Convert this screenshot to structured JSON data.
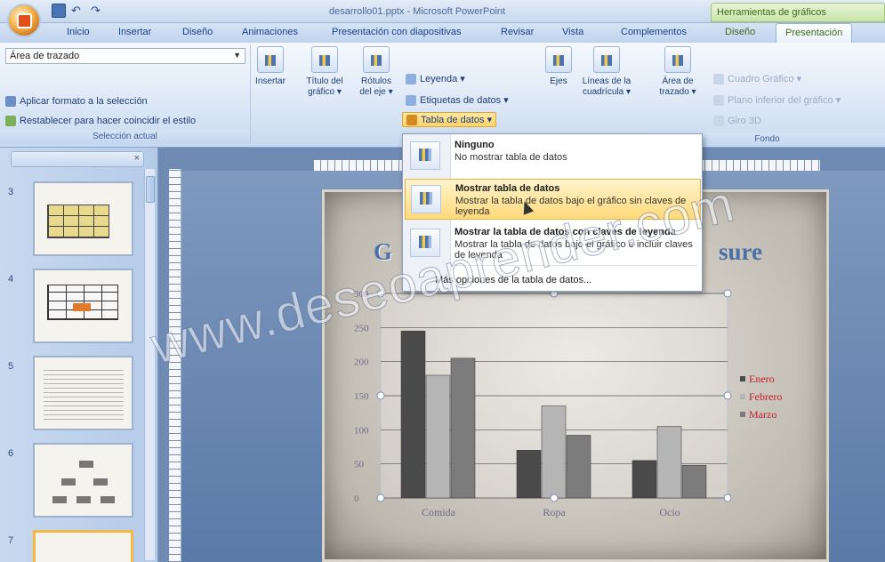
{
  "window": {
    "title": "desarrollo01.pptx - Microsoft PowerPoint",
    "contextual_title": "Herramientas de gráficos"
  },
  "tabs": [
    {
      "label": "Inicio"
    },
    {
      "label": "Insertar"
    },
    {
      "label": "Diseño"
    },
    {
      "label": "Animaciones"
    },
    {
      "label": "Presentación con diapositivas"
    },
    {
      "label": "Revisar"
    },
    {
      "label": "Vista"
    },
    {
      "label": "Complementos"
    },
    {
      "label": "Diseño"
    },
    {
      "label": "Presentación"
    }
  ],
  "ribbon": {
    "seleccion": {
      "combo_value": "Área de trazado",
      "format_btn": "Aplicar formato a la selección",
      "reset_btn": "Restablecer para hacer coincidir el estilo",
      "group_label": "Selección actual"
    },
    "insertar_btn": "Insertar",
    "titulo_btn": "Título del gráfico ▾",
    "rotulos_btn": "Rótulos del eje ▾",
    "leyenda_btn": "Leyenda ▾",
    "etiquetas_btn": "Etiquetas de datos ▾",
    "tabla_btn": "Tabla de datos ▾",
    "ejes_btn": "Ejes",
    "lineas_btn": "Líneas de la cuadrícula ▾",
    "area_btn": "Área de trazado ▾",
    "cuadro_btn": "Cuadro Gráfico ▾",
    "plano_btn": "Plano inferior del gráfico ▾",
    "giro_btn": "Giro 3D",
    "fondo_label": "Fondo"
  },
  "menu": {
    "items": [
      {
        "title": "Ninguno",
        "desc": "No mostrar tabla de datos"
      },
      {
        "title": "Mostrar tabla de datos",
        "desc": "Mostrar la tabla de datos bajo el gráfico sin claves de leyenda"
      },
      {
        "title": "Mostrar la tabla de datos con claves de leyenda",
        "desc": "Mostrar la tabla de datos bajo el gráfico e incluir claves de leyenda"
      }
    ],
    "more": "Más opciones de la tabla de datos..."
  },
  "slides_panel": {
    "numbers": [
      "3",
      "4",
      "5",
      "6",
      "7"
    ]
  },
  "slide": {
    "title_left": "G",
    "title_right": "sure"
  },
  "watermark": "www.deseoaprender.com",
  "colors": {
    "enero": "#4a4a4a",
    "febrero": "#b5b5b5",
    "marzo": "#7c7c7c",
    "legend_text": "#c0202a",
    "axis_text": "#6b6b8c"
  },
  "chart_data": {
    "type": "bar",
    "categories": [
      "Comida",
      "Ropa",
      "Ocio"
    ],
    "series": [
      {
        "name": "Enero",
        "values": [
          245,
          70,
          55
        ]
      },
      {
        "name": "Febrero",
        "values": [
          180,
          135,
          105
        ]
      },
      {
        "name": "Marzo",
        "values": [
          205,
          92,
          48
        ]
      }
    ],
    "yticks": [
      0,
      50,
      100,
      150,
      200,
      250,
      300
    ],
    "ylim": [
      0,
      300
    ],
    "grid": true,
    "legend": "right"
  }
}
